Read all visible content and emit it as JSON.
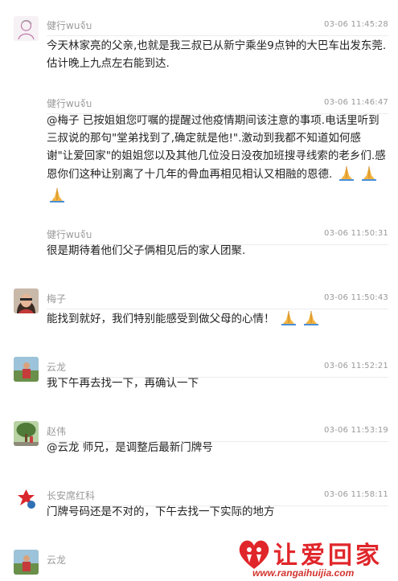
{
  "comments": [
    {
      "username": "健行wuจ้บ",
      "timestamp": "03-06 11:45:28",
      "text": "今天林家亮的父亲,也就是我三叔已从新宁乘坐9点钟的大巴车出发东莞.估计晚上九点左右能到达.",
      "avatar": "pink-sketch-avatar"
    },
    {
      "username": "健行wuจ้บ",
      "timestamp": "03-06 11:46:47",
      "text": "@梅子 已按姐姐您叮嘱的提醒过他疫情期间该注意的事项.电话里听到三叔说的那句\"堂弟找到了,确定就是他!\".激动到我都不知道如何感谢\"让爱回家\"的姐姐您以及其他几位没日没夜加班搜寻线索的老乡们.感恩你们这种让别离了十几年的骨血再相见相认又相融的恩德.",
      "emoji_count": 3,
      "emoji": "folded-hands-icon"
    },
    {
      "username": "健行wuจ้บ",
      "timestamp": "03-06 11:50:31",
      "text": "很是期待着他们父子俩相见后的家人团聚."
    },
    {
      "username": "梅子",
      "timestamp": "03-06 11:50:43",
      "text": "能找到就好，我们特别能感受到做父母的心情！",
      "emoji_count": 2,
      "emoji": "folded-hands-icon",
      "avatar": "woman-photo-avatar"
    },
    {
      "username": "云龙",
      "timestamp": "03-06 11:52:21",
      "text": "我下午再去找一下，再确认一下",
      "avatar": "outdoor-photo-avatar"
    },
    {
      "username": "赵伟",
      "timestamp": "03-06 11:53:19",
      "text": "@云龙 师兄，是调整后最新门牌号",
      "avatar": "tree-photo-avatar"
    },
    {
      "username": "长安席红科",
      "timestamp": "03-06 11:58:11",
      "text": "门牌号码还是不对的，下午去找一下实际的地方",
      "avatar": "logo-avatar"
    },
    {
      "username": "云龙",
      "timestamp": "",
      "text": "",
      "avatar": "outdoor-photo-avatar"
    }
  ],
  "watermark": {
    "brand": "让爱回家",
    "url": "www.rangaihuijia.com",
    "color": "#e0262a"
  }
}
